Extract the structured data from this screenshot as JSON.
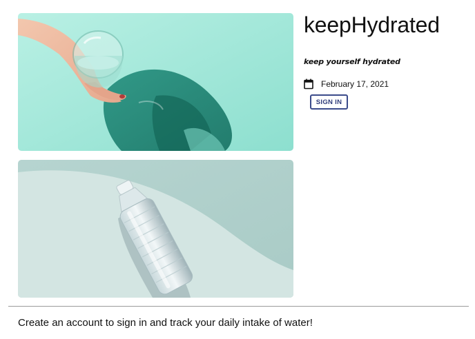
{
  "app": {
    "title": "keepHydrated",
    "tagline": "keep yourself hydrated"
  },
  "event": {
    "date": "February 17, 2021",
    "icon": "calendar-icon"
  },
  "actions": {
    "sign_in_label": "SIGN IN"
  },
  "images": {
    "first": "hand-holding-water-glass-photo",
    "second": "plastic-water-bottle-photo"
  },
  "footer": {
    "message": "Create an account to sign in and track your daily intake of water!"
  },
  "colors": {
    "button_border": "#3a4a8a",
    "button_text": "#2e3b7a",
    "glass_photo_bg": "#a9e9dc",
    "bottle_photo_bg": "#cfe2de",
    "divider": "#9a9a9a"
  }
}
